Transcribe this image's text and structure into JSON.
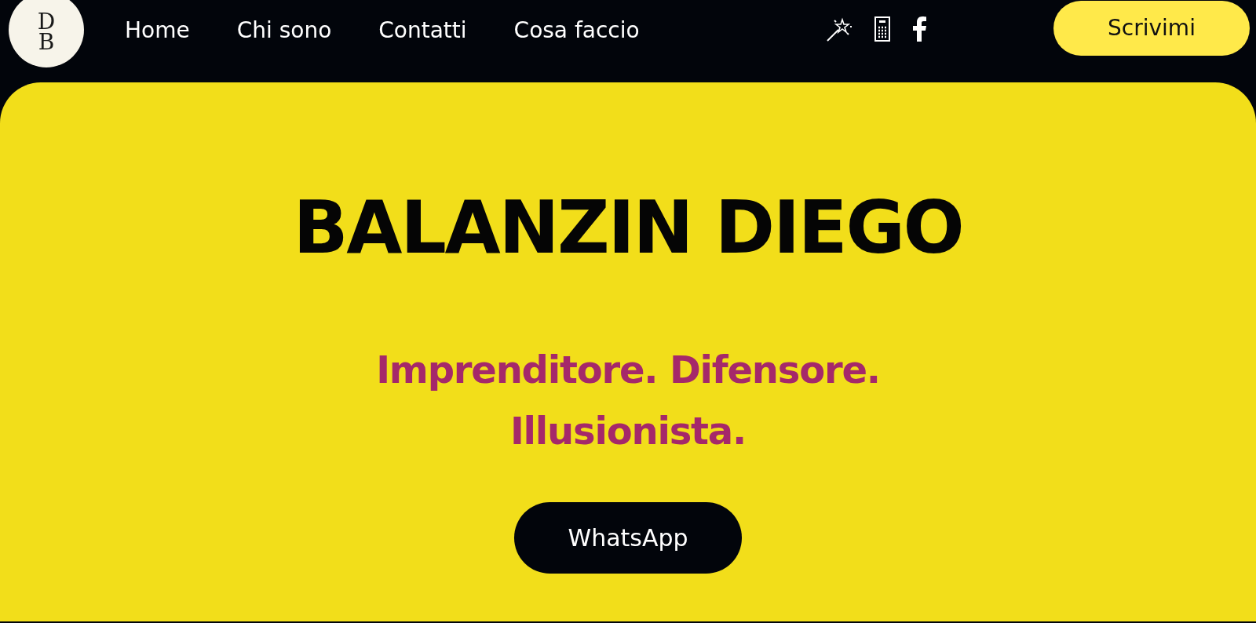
{
  "logo": {
    "top": "D",
    "bottom": "B"
  },
  "nav": {
    "links": [
      "Home",
      "Chi sono",
      "Contatti",
      "Cosa faccio"
    ],
    "cta": "Scrivimi"
  },
  "hero": {
    "title": "BALANZIN DIEGO",
    "subtitle_lines": [
      "Imprenditore. Difensore.",
      "Illusionista."
    ],
    "button": "WhatsApp"
  }
}
